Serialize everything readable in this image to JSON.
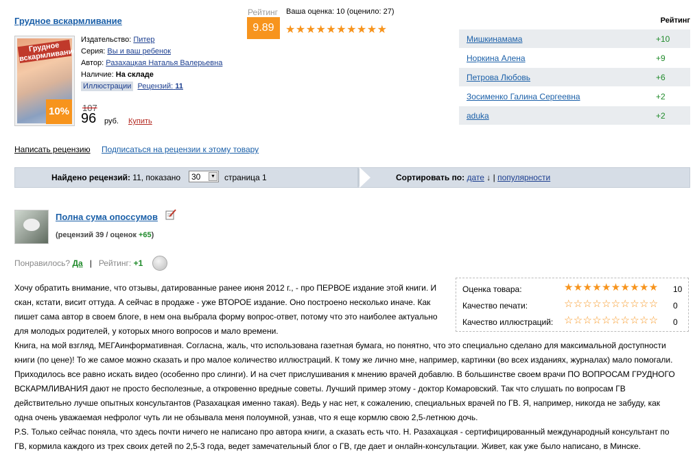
{
  "book": {
    "title": "Грудное вскармливание",
    "cover_text": "Грудное вскармливание",
    "discount": "10%",
    "publisher_label": "Издательство:",
    "publisher": "Питер",
    "series_label": "Серия:",
    "series": "Вы и ваш ребенок",
    "author_label": "Автор:",
    "author": "Разахацкая Наталья Валерьевна",
    "stock_label": "Наличие:",
    "stock": "На складе",
    "illustrations": "Иллюстрации",
    "reviews_label": "Рецензий:",
    "reviews_count": "11",
    "old_price": "107",
    "price": "96",
    "currency": "руб.",
    "buy": "Купить"
  },
  "rating": {
    "label": "Рейтинг",
    "value": "9.89",
    "your_rating": "Ваша оценка: 10 (оценило: 27)",
    "stars": "★★★★★★★★★★",
    "stars_value": 10
  },
  "top_users": {
    "header": "Рейтинг",
    "rows": [
      {
        "name": "Мишкинамама",
        "score": "+10"
      },
      {
        "name": "Норкина Алена",
        "score": "+9"
      },
      {
        "name": "Петрова Любовь",
        "score": "+6"
      },
      {
        "name": "Зосименко Галина Сергеевна",
        "score": "+2"
      },
      {
        "name": "aduka",
        "score": "+2"
      }
    ]
  },
  "links": {
    "write_review": "Написать рецензию",
    "subscribe": "Подписаться на рецензии к этому товару"
  },
  "listing": {
    "found_label": "Найдено рецензий:",
    "found_rest": "11, показано",
    "per_page": "30",
    "page_label": "страница 1",
    "sort_label": "Сортировать по:",
    "sort_date": "дате",
    "sort_arrow": "↓",
    "sort_sep": "|",
    "sort_popular": "популярности"
  },
  "review": {
    "author": "Полна сума опоссумов",
    "stats_prefix": "(рецензий 39 / оценок ",
    "stats_plus": "+65",
    "stats_suffix": ")",
    "liked_label": "Понравилось?",
    "liked_yes": "Да",
    "sep": "|",
    "rating_label": "Рейтинг:",
    "rating_value": "+1",
    "scores": [
      {
        "label": "Оценка товара:",
        "stars": "★★★★★★★★★★",
        "value": "10"
      },
      {
        "label": "Качество печати:",
        "stars": "☆☆☆☆☆☆☆☆☆☆",
        "value": "0"
      },
      {
        "label": "Качество иллюстраций:",
        "stars": "☆☆☆☆☆☆☆☆☆☆",
        "value": "0"
      }
    ],
    "text_lines_top": [
      "Хочу обратить внимание, что отзывы, датированные ранее июня 2012 г., - про ПЕРВОЕ издание этой книги. И",
      "скан, кстати, висит оттуда. А сейчас в продаже - уже ВТОРОЕ издание. Оно построено несколько иначе. Как",
      "пишет сама автор в своем блоге, в нем она выбрала форму вопрос-ответ, потому что это наиболее актуально",
      "для молодых родителей, у которых много вопросов и мало времени."
    ],
    "text_lines_bottom": [
      "Книга, на мой взгляд, МЕГАинформативная. Согласна, жаль, что использована газетная бумага, но понятно, что это специально сделано для максимальной доступности",
      "книги (по цене)! То же самое можно сказать и про малое количество иллюстраций. К тому же лично мне, например, картинки (во всех изданиях, журналах) мало помогали.",
      "Приходилось все равно искать видео (особенно про слинги). И на счет прислушивания к мнению врачей добавлю. В большинстве своем врачи ПО ВОПРОСАМ ГРУДНОГО",
      "ВСКАРМЛИВАНИЯ дают не просто бесполезные, а откровенно вредные советы. Лучший пример этому - доктор Комаровский. Так что слушать по вопросам ГВ",
      "действительно лучше опытных консультантов (Разахацкая именно такая). Ведь у нас нет, к сожалению, специальных врачей по ГВ. Я, например, никогда не забуду, как",
      "одна очень уважаемая нефролог чуть ли не обзывала меня полоумной, узнав, что я еще кормлю свою 2,5-летнюю дочь.",
      "P.S. Только сейчас поняла, что здесь почти ничего не написано про автора книги, а сказать есть что. Н. Разахацкая - сертифицированный международный консультант по",
      "ГВ, кормила каждого из трех своих детей по 2,5-3 года, ведет замечательный блог о ГВ, где дает и онлайн-консультации. Живет, как уже было написано, в Минске."
    ]
  }
}
